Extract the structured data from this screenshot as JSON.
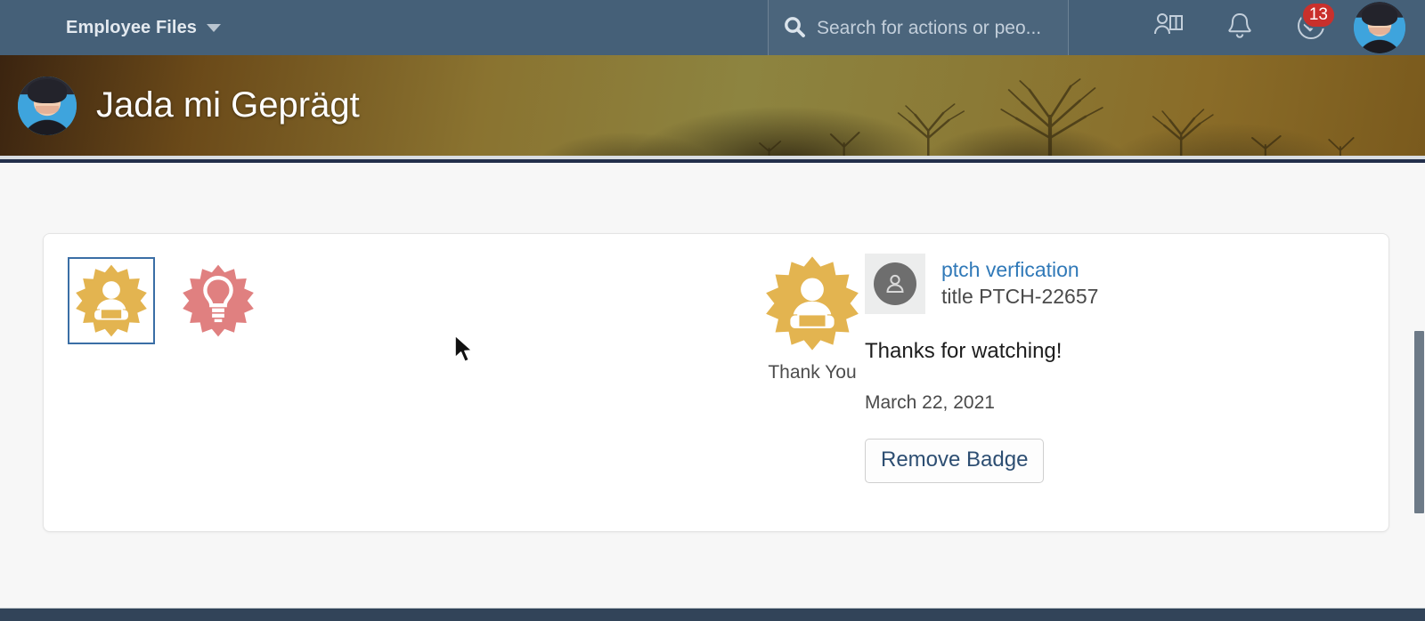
{
  "topnav": {
    "brand_label": "Employee Files",
    "brand_caret_icon": "chevron-down-icon",
    "search": {
      "icon": "search-icon",
      "placeholder": "Search for actions or peo...",
      "value": ""
    },
    "icons": [
      {
        "name": "org-chart-icon",
        "label": "Org Chart"
      },
      {
        "name": "bell-icon",
        "label": "Notifications"
      },
      {
        "name": "todo-check-icon",
        "label": "To-Do",
        "badge_count": "13"
      }
    ],
    "avatar": {
      "name": "user-avatar",
      "label": "Jada mi Geprägt"
    },
    "badge_color": "#c9302c",
    "nav_color": "#456078"
  },
  "banner": {
    "avatar_name": "profile-avatar",
    "name": "Jada mi Geprägt"
  },
  "card": {
    "badge_tiles": [
      {
        "name": "badge-tile-thank-you",
        "label": "Thank You",
        "icon": "person-presenter-badge-icon",
        "color": "#e3b450",
        "selected": true
      },
      {
        "name": "badge-tile-bright-idea",
        "label": "Bright Idea",
        "icon": "lightbulb-badge-icon",
        "color": "#e08080",
        "selected": false
      }
    ],
    "hero": {
      "label": "Thank You",
      "icon": "person-presenter-badge-icon",
      "color": "#e3b450"
    },
    "detail": {
      "thumb_icon": "person-icon",
      "sender_link": "ptch verfication",
      "sender_title": "title PTCH-22657",
      "message": "Thanks for watching!",
      "date": "March 22, 2021",
      "remove_label": "Remove Badge",
      "link_color": "#3079b8"
    }
  },
  "colors": {
    "page_background": "#f7f7f7",
    "card_background": "#ffffff",
    "footer": "#324459",
    "selection_border": "#3a6ea5"
  }
}
